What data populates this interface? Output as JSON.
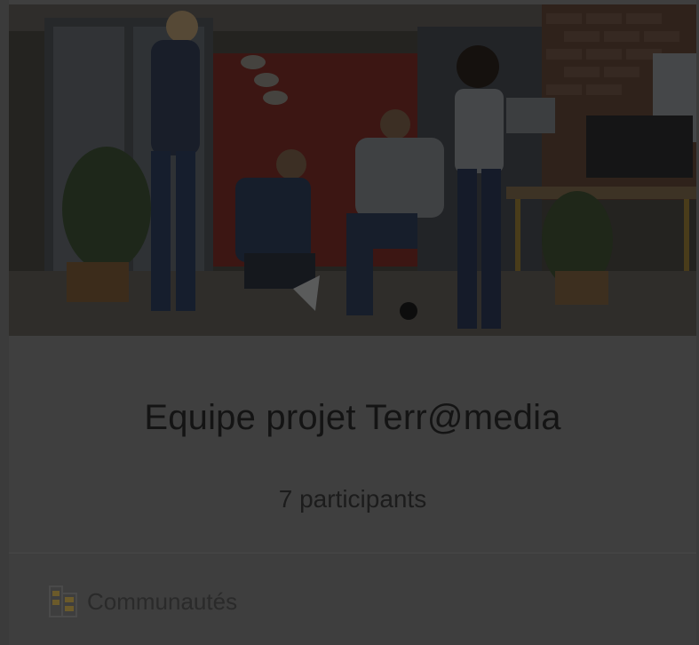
{
  "card": {
    "title": "Equipe projet Terr@media",
    "participants": "7 participants",
    "footer_link_label": "Communautés",
    "footer_icon": "community-building-icon",
    "image_description": ""
  },
  "colors": {
    "backdrop": "#3b3b3b",
    "card_background": "#3f3f3f",
    "title_text": "#141414",
    "footer_text": "#2a2a2a",
    "icon_accent": "#6b5a2a"
  }
}
